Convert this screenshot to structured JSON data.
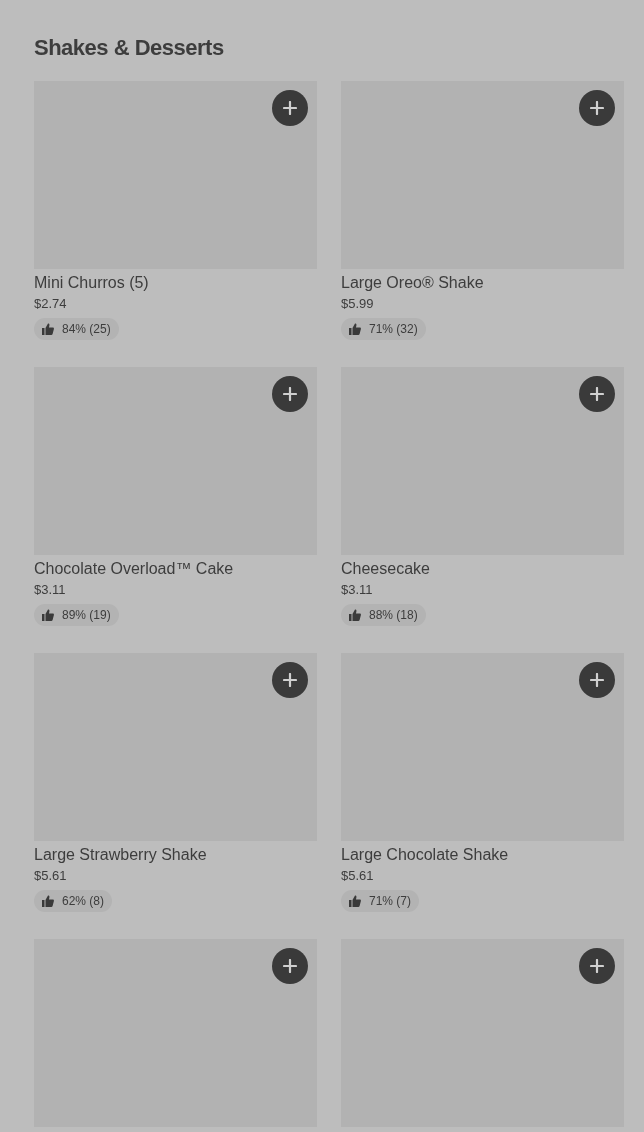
{
  "section": {
    "title": "Shakes & Desserts"
  },
  "items": [
    {
      "kind": "product",
      "name": "Mini Churros (5)",
      "price": "$2.74",
      "rating": "84% (25)"
    },
    {
      "kind": "product",
      "name": "Large Oreo® Shake",
      "price": "$5.99",
      "rating": "71% (32)"
    },
    {
      "kind": "product",
      "name": "Chocolate Overload™ Cake",
      "price": "$3.11",
      "rating": "89% (19)"
    },
    {
      "kind": "product",
      "name": "Cheesecake",
      "price": "$3.11",
      "rating": "88% (18)"
    },
    {
      "kind": "product",
      "name": "Large Strawberry Shake",
      "price": "$5.61",
      "rating": "62% (8)"
    },
    {
      "kind": "product",
      "name": "Large Chocolate Shake",
      "price": "$5.61",
      "rating": "71% (7)"
    },
    {
      "kind": "image-only"
    },
    {
      "kind": "image-only"
    }
  ]
}
